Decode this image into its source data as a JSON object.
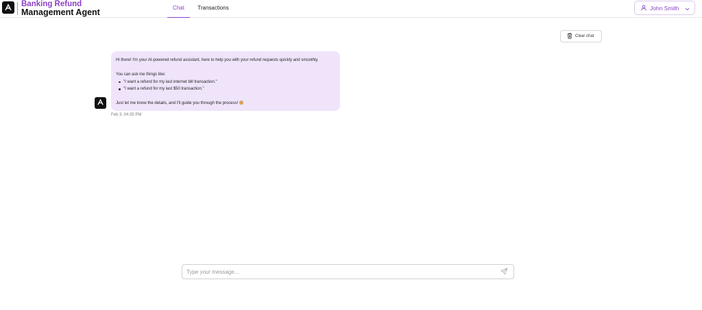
{
  "brand": {
    "line1": "Banking Refund",
    "line2": "Management Agent"
  },
  "nav": {
    "tabs": [
      {
        "label": "Chat",
        "active": true
      },
      {
        "label": "Transactions",
        "active": false
      }
    ]
  },
  "user": {
    "name": "John Smith"
  },
  "toolbar": {
    "clear_label": "Clear chat"
  },
  "chat": {
    "messages": [
      {
        "sender": "bot",
        "greeting": "Hi there! I'm your AI-powered refund assistant, here to help you with your refund requests quickly and smoothly.",
        "intro": "You can ask me things like:",
        "examples": [
          "\"I want a refund for my last internet bill transaction.\"",
          "\"I want a refund for my last $50 transaction.\""
        ],
        "closing": "Just let me know the details, and I'll guide you through the process!",
        "timestamp": "Feb 3, 04:35 PM"
      }
    ]
  },
  "composer": {
    "placeholder": "Type your message..."
  },
  "colors": {
    "accent": "#8a3ec6",
    "bubble": "#f0e4fb",
    "logo_bg": "#111111"
  },
  "icons": {
    "logo": "anthropic-logo-icon",
    "user": "user-icon",
    "dropdown": "chevron-down-icon",
    "clear": "trash-icon",
    "send": "send-icon"
  }
}
